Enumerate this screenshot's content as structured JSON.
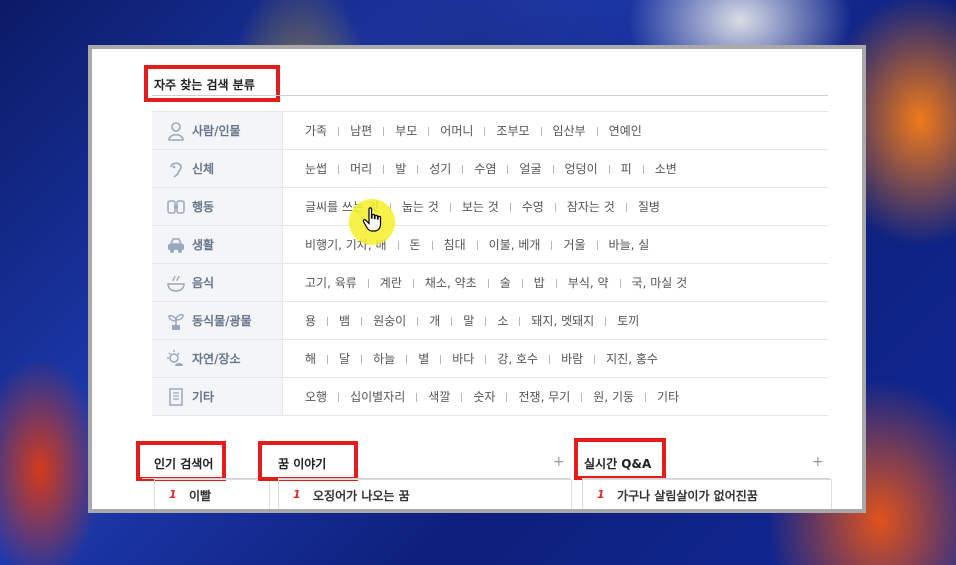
{
  "frequent_section": {
    "title": "자주 찾는 검색 분류",
    "categories": [
      {
        "name": "사람/인물",
        "icon": "person-icon",
        "items": [
          "가족",
          "남편",
          "부모",
          "어머니",
          "조부모",
          "임산부",
          "연예인"
        ]
      },
      {
        "name": "신체",
        "icon": "body-icon",
        "items": [
          "눈썹",
          "머리",
          "발",
          "성기",
          "수염",
          "얼굴",
          "엉덩이",
          "피",
          "소변"
        ]
      },
      {
        "name": "행동",
        "icon": "action-icon",
        "items": [
          "글씨를 쓰는 것",
          "눕는 것",
          "보는 것",
          "수영",
          "잠자는 것",
          "질병"
        ]
      },
      {
        "name": "생활",
        "icon": "car-icon",
        "items": [
          "비행기, 기차, 배",
          "돈",
          "침대",
          "이불, 베개",
          "거울",
          "바늘, 실"
        ]
      },
      {
        "name": "음식",
        "icon": "food-icon",
        "items": [
          "고기, 육류",
          "계란",
          "채소, 약초",
          "술",
          "밥",
          "부식, 약",
          "국, 마실 것"
        ]
      },
      {
        "name": "동식물/광물",
        "icon": "plant-icon",
        "items": [
          "용",
          "뱀",
          "원숭이",
          "개",
          "말",
          "소",
          "돼지, 멧돼지",
          "토끼"
        ]
      },
      {
        "name": "자연/장소",
        "icon": "nature-icon",
        "items": [
          "해",
          "달",
          "하늘",
          "별",
          "바다",
          "강, 호수",
          "바람",
          "지진, 홍수"
        ]
      },
      {
        "name": "기타",
        "icon": "book-icon",
        "items": [
          "오행",
          "십이별자리",
          "색깔",
          "숫자",
          "전쟁, 무기",
          "원, 기둥",
          "기타"
        ]
      }
    ]
  },
  "popular": {
    "title": "인기 검색어",
    "rank": "1",
    "text": "이빨"
  },
  "dream_story": {
    "title": "꿈 이야기",
    "plus": "+",
    "rank": "1",
    "text": "오징어가 나오는 꿈"
  },
  "qna": {
    "title": "실시간 Q&A",
    "plus": "+",
    "rank": "1",
    "text": "가구나 살림살이가 없어진꿈"
  },
  "colors": {
    "highlight": "#e41c1c",
    "cursor_highlight": "#f4f028",
    "rank": "#e02a2a"
  }
}
